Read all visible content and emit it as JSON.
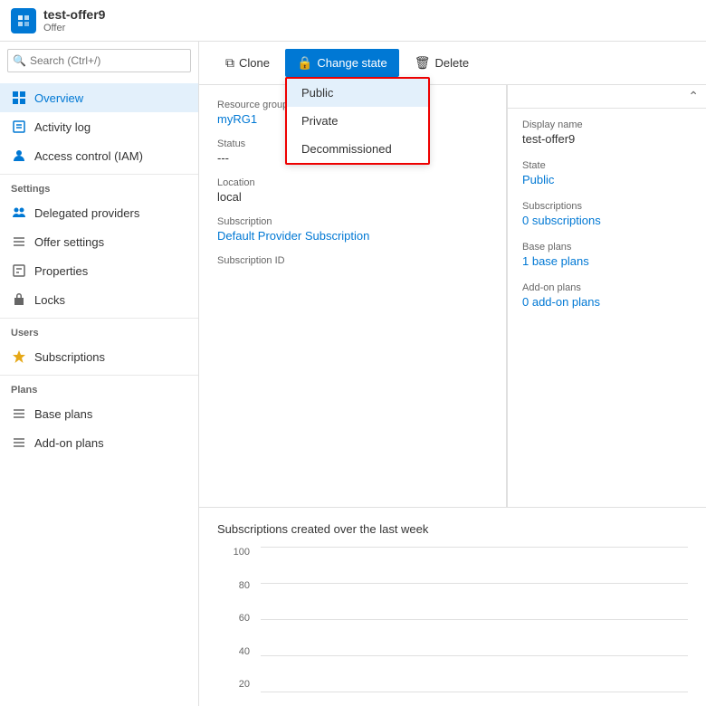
{
  "header": {
    "icon_color": "#0078d4",
    "title": "test-offer9",
    "subtitle": "Offer"
  },
  "sidebar": {
    "search_placeholder": "Search (Ctrl+/)",
    "items": [
      {
        "id": "overview",
        "label": "Overview",
        "active": true,
        "icon": "overview"
      },
      {
        "id": "activity-log",
        "label": "Activity log",
        "active": false,
        "icon": "activity"
      },
      {
        "id": "access-control",
        "label": "Access control (IAM)",
        "active": false,
        "icon": "access"
      }
    ],
    "sections": [
      {
        "label": "Settings",
        "items": [
          {
            "id": "delegated-providers",
            "label": "Delegated providers",
            "icon": "delegated"
          },
          {
            "id": "offer-settings",
            "label": "Offer settings",
            "icon": "offer-settings"
          },
          {
            "id": "properties",
            "label": "Properties",
            "icon": "properties"
          },
          {
            "id": "locks",
            "label": "Locks",
            "icon": "locks"
          }
        ]
      },
      {
        "label": "Users",
        "items": [
          {
            "id": "subscriptions",
            "label": "Subscriptions",
            "icon": "subscriptions"
          }
        ]
      },
      {
        "label": "Plans",
        "items": [
          {
            "id": "base-plans",
            "label": "Base plans",
            "icon": "base-plans"
          },
          {
            "id": "add-on-plans",
            "label": "Add-on plans",
            "icon": "add-on-plans"
          }
        ]
      }
    ]
  },
  "toolbar": {
    "clone_label": "Clone",
    "change_state_label": "Change state",
    "delete_label": "Delete"
  },
  "dropdown": {
    "visible": true,
    "items": [
      {
        "id": "public",
        "label": "Public",
        "selected": true
      },
      {
        "id": "private",
        "label": "Private",
        "selected": false
      },
      {
        "id": "decommissioned",
        "label": "Decommissioned",
        "selected": false
      }
    ]
  },
  "detail": {
    "resource_group_label": "Resource group",
    "resource_group_value": "myRG1",
    "status_label": "Status",
    "status_value": "---",
    "location_label": "Location",
    "location_value": "local",
    "subscription_label": "Subscription",
    "subscription_value": "Default Provider Subscription",
    "subscription_id_label": "Subscription ID",
    "subscription_id_value": ""
  },
  "right_panel": {
    "display_name_label": "Display name",
    "display_name_value": "test-offer9",
    "state_label": "State",
    "state_value": "Public",
    "subscriptions_label": "Subscriptions",
    "subscriptions_value": "0 subscriptions",
    "base_plans_label": "Base plans",
    "base_plans_value": "1 base plans",
    "add_on_plans_label": "Add-on plans",
    "add_on_plans_value": "0 add-on plans"
  },
  "chart": {
    "title": "Subscriptions created over the last week",
    "y_labels": [
      "100",
      "80",
      "60",
      "40",
      "20"
    ]
  }
}
